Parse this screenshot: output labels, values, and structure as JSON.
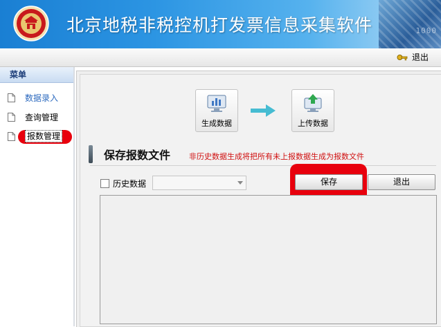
{
  "header": {
    "title": "北京地税非税控机打发票信息采集软件",
    "deco_text": "1000"
  },
  "topbar": {
    "logout_label": "退出"
  },
  "sidebar": {
    "title": "菜单",
    "items": [
      {
        "label": "数据录入"
      },
      {
        "label": "查询管理"
      },
      {
        "label": "报数管理"
      }
    ]
  },
  "steps": {
    "generate_label": "生成数据",
    "upload_label": "上传数据"
  },
  "section": {
    "title": "保存报数文件",
    "note": "非历史数据生成将把所有未上报数据生成为报数文件"
  },
  "form": {
    "history_checkbox_label": "历史数据",
    "history_checked": false,
    "history_select_value": ""
  },
  "buttons": {
    "save_label": "保存",
    "exit_label": "退出"
  },
  "colors": {
    "highlight_red": "#e8000d",
    "header_blue": "#1a7fd3",
    "link_blue": "#2e6bbf",
    "note_red": "#d01010"
  }
}
